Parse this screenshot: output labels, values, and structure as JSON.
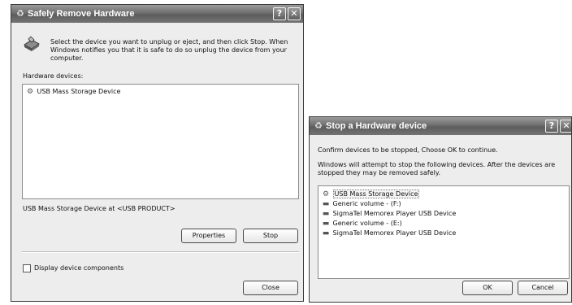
{
  "remove_dialog": {
    "title": "Safely Remove Hardware",
    "help_button": "?",
    "close_x": "✕",
    "instructions": "Select the device you want to unplug or eject, and then click Stop. When Windows notifies you that it is safe to do so unplug the device from your computer.",
    "devices_label": "Hardware devices:",
    "devices": [
      {
        "label": "USB Mass Storage Device",
        "icon": "usb-device-icon"
      }
    ],
    "selected_device_description": "USB Mass Storage Device at <USB PRODUCT>",
    "properties_button": "Properties",
    "stop_button": "Stop",
    "display_components_label": "Display device components",
    "display_components_checked": false,
    "close_button": "Close"
  },
  "stop_dialog": {
    "title": "Stop a Hardware device",
    "help_button": "?",
    "close_x": "✕",
    "confirm_text": "Confirm devices to be stopped, Choose OK to continue.",
    "info_text": "Windows will attempt to stop the following devices. After the devices are stopped they may be removed safely.",
    "devices": [
      {
        "label": "USB Mass Storage Device",
        "icon": "usb-device-icon"
      },
      {
        "label": "Generic volume - (F:)",
        "icon": "drive-icon"
      },
      {
        "label": "SigmaTel Memorex Player USB Device",
        "icon": "drive-icon"
      },
      {
        "label": "Generic volume - (E:)",
        "icon": "drive-icon"
      },
      {
        "label": "SigmaTel Memorex Player USB Device",
        "icon": "drive-icon"
      }
    ],
    "ok_button": "OK",
    "cancel_button": "Cancel"
  }
}
